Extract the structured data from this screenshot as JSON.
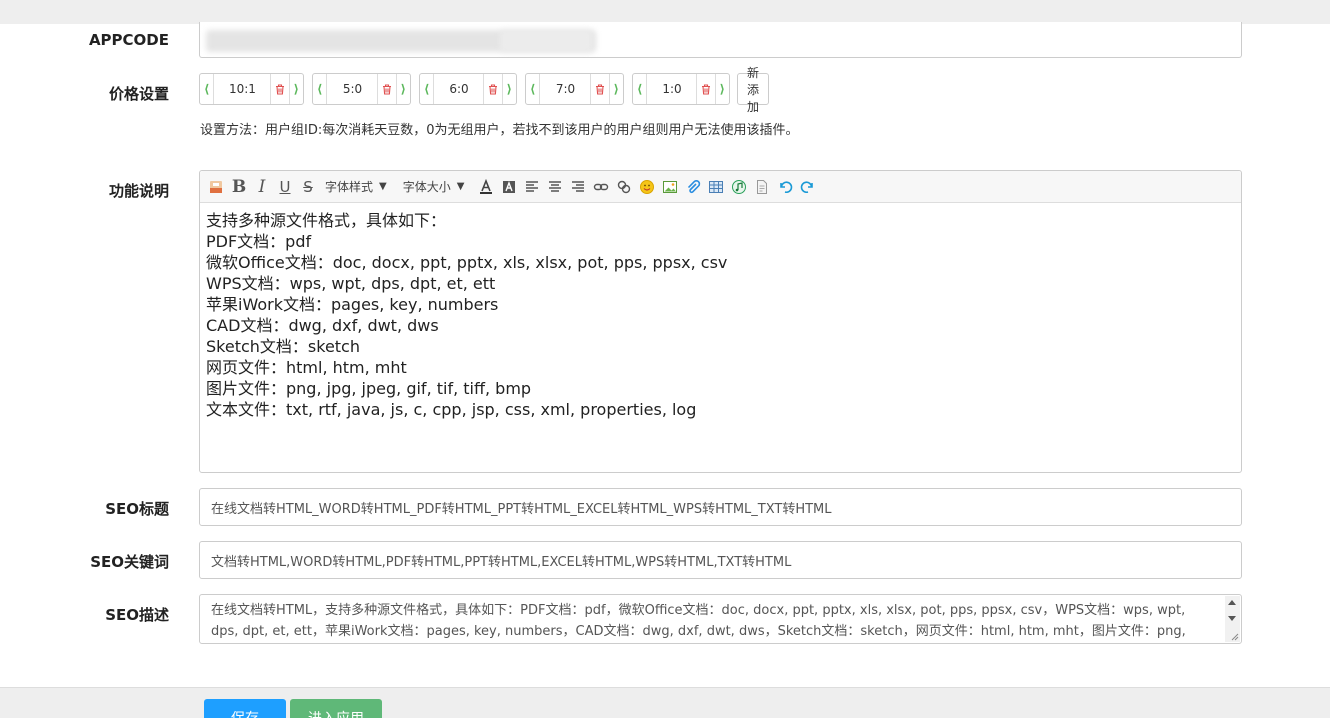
{
  "appcode": {
    "label": "APPCODE"
  },
  "price": {
    "label": "价格设置",
    "items": [
      "10:1",
      "5:0",
      "6:0",
      "7:0",
      "1:0"
    ],
    "add_label": "新添加",
    "help": "设置方法：用户组ID:每次消耗天豆数，0为无组用户，若找不到该用户的用户组则用户无法使用该插件。"
  },
  "func": {
    "label": "功能说明",
    "toolbar": {
      "font_style": "字体样式",
      "font_size": "字体大小"
    },
    "lines": [
      "支持多种源文件格式，具体如下：",
      "PDF文档：pdf",
      "微软Office文档：doc, docx, ppt, pptx, xls, xlsx, pot, pps, ppsx, csv",
      "WPS文档：wps, wpt, dps, dpt, et, ett",
      "苹果iWork文档：pages, key, numbers",
      "CAD文档：dwg, dxf, dwt, dws",
      "Sketch文档：sketch",
      "网页文件：html, htm, mht",
      "图片文件：png, jpg, jpeg, gif, tif, tiff, bmp",
      "文本文件：txt, rtf, java, js, c, cpp, jsp, css, xml, properties, log"
    ]
  },
  "seo": {
    "title_label": "SEO标题",
    "title_value": "在线文档转HTML_WORD转HTML_PDF转HTML_PPT转HTML_EXCEL转HTML_WPS转HTML_TXT转HTML",
    "keywords_label": "SEO关键词",
    "keywords_value": "文档转HTML,WORD转HTML,PDF转HTML,PPT转HTML,EXCEL转HTML,WPS转HTML,TXT转HTML",
    "desc_label": "SEO描述",
    "desc_value": "在线文档转HTML，支持多种源文件格式，具体如下：PDF文档：pdf，微软Office文档：doc, docx, ppt, pptx, xls, xlsx, pot, pps, ppsx, csv，WPS文档：wps, wpt, dps, dpt, et, ett，苹果iWork文档：pages, key, numbers，CAD文档：dwg, dxf, dwt, dws，Sketch文档：sketch，网页文件：html, htm, mht，图片文件：png, jpg, jpeg, gif, tif, tiff, bmp，文本文件：txt, rtf, java, js, c, cpp, jsp, css, xml, properties, log"
  },
  "footer": {
    "save_label": "保存",
    "enter_label": "进入应用"
  },
  "colors": {
    "save": "#1e9fff",
    "enter": "#5fb878",
    "arrow": "#5cb85c",
    "delete": "#e05050"
  }
}
